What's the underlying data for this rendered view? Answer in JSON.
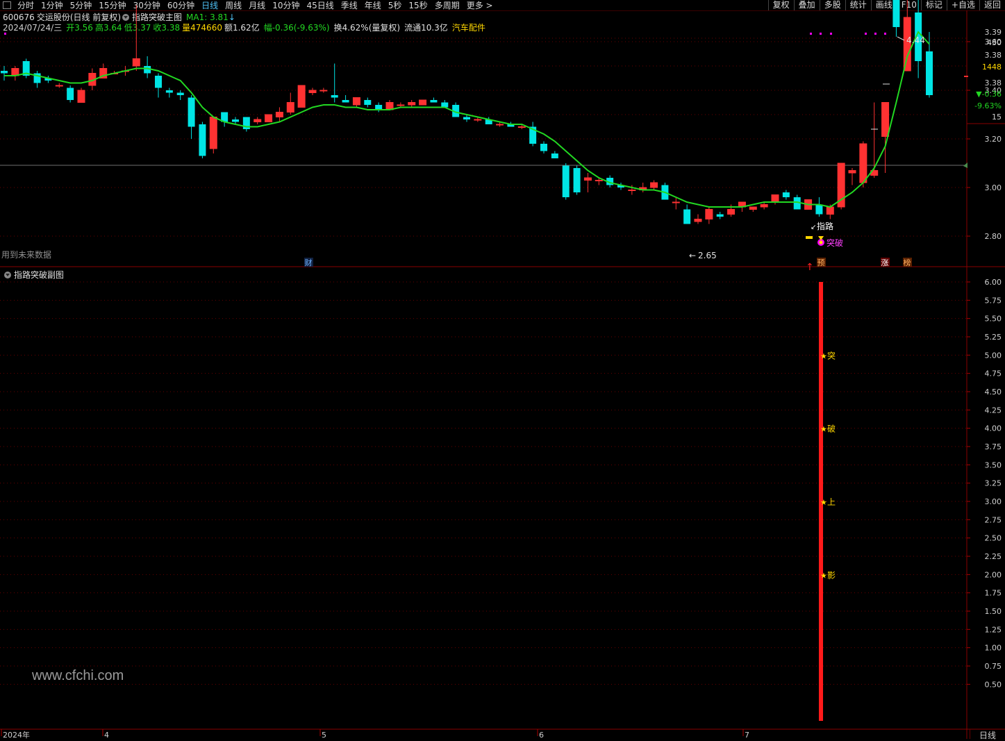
{
  "toolbar": {
    "periods": [
      "分时",
      "1分钟",
      "5分钟",
      "15分钟",
      "30分钟",
      "60分钟",
      "日线",
      "周线",
      "月线",
      "10分钟",
      "45日线",
      "季线",
      "年线",
      "5秒",
      "15秒",
      "多周期",
      "更多 >"
    ],
    "active_period": "日线",
    "right_buttons": [
      "复权",
      "叠加",
      "多股",
      "统计",
      "画线",
      "F10",
      "标记",
      "+自选",
      "返回"
    ]
  },
  "stock": {
    "code": "600676",
    "name": "交运股份",
    "mode": "(日线 前复权)",
    "indicator_main": "指路突破主图",
    "ma_label": "MA1: 3.81",
    "ma_arrow": "↓",
    "date": "2024/07/24/三",
    "open": "开3.56",
    "high": "高3.64",
    "low": "低3.37",
    "close": "收3.38",
    "volume": "量474660",
    "amount": "额1.62亿",
    "change": "幅-0.36(-9.63%)",
    "turnover": "换4.62%(量复权)",
    "float_cap": "流通10.3亿",
    "sector": "汽车配件"
  },
  "main_panel": {
    "note": "用到未来数据",
    "y_ticks": [
      "3.60",
      "3.40",
      "3.20",
      "3.00",
      "2.80"
    ],
    "side_stats": [
      "3.39",
      "430",
      "3.38",
      "1448",
      "3.38",
      "▼-0.36",
      "-9.63%",
      "15"
    ],
    "annotations": {
      "high_label": "4.44",
      "low_label": "2.65",
      "zhilu_label": "指路",
      "tupo_label": "突破",
      "cai_label": "财",
      "yu_label": "预",
      "zhang_label": "涨",
      "bang_label": "榜"
    }
  },
  "sub_panel": {
    "title": "指路突破副图",
    "y_ticks": [
      "6.00",
      "5.75",
      "5.50",
      "5.25",
      "5.00",
      "4.75",
      "4.50",
      "4.25",
      "4.00",
      "3.75",
      "3.50",
      "3.25",
      "3.00",
      "2.75",
      "2.50",
      "2.25",
      "2.00",
      "1.75",
      "1.50",
      "1.25",
      "1.00",
      "0.75",
      "0.50"
    ],
    "signals": [
      "突",
      "破",
      "上",
      "影"
    ]
  },
  "x_axis": {
    "labels": [
      "2024年",
      "4",
      "5",
      "6",
      "7"
    ]
  },
  "period_button": "日线",
  "watermark": "www.cfchi.com",
  "colors": {
    "up": "#ff3232",
    "down": "#00e5e5",
    "ma": "#22d822",
    "signal_bar": "#ff1a1a",
    "star": "#ffd700",
    "magenta": "#ff00ff"
  },
  "chart_data": {
    "type": "candlestick",
    "y_range": [
      2.6,
      3.95
    ],
    "candles": [
      {
        "o": 3.48,
        "h": 3.5,
        "l": 3.44,
        "c": 3.47
      },
      {
        "o": 3.46,
        "h": 3.5,
        "l": 3.44,
        "c": 3.49
      },
      {
        "o": 3.52,
        "h": 3.53,
        "l": 3.45,
        "c": 3.46
      },
      {
        "o": 3.47,
        "h": 3.48,
        "l": 3.41,
        "c": 3.43
      },
      {
        "o": 3.45,
        "h": 3.46,
        "l": 3.43,
        "c": 3.44
      },
      {
        "o": 3.42,
        "h": 3.43,
        "l": 3.41,
        "c": 3.42
      },
      {
        "o": 3.41,
        "h": 3.42,
        "l": 3.35,
        "c": 3.36
      },
      {
        "o": 3.35,
        "h": 3.41,
        "l": 3.35,
        "c": 3.4
      },
      {
        "o": 3.42,
        "h": 3.49,
        "l": 3.4,
        "c": 3.47
      },
      {
        "o": 3.45,
        "h": 3.51,
        "l": 3.45,
        "c": 3.49
      },
      {
        "o": 3.47,
        "h": 3.48,
        "l": 3.47,
        "c": 3.47
      },
      {
        "o": 3.48,
        "h": 3.5,
        "l": 3.46,
        "c": 3.48
      },
      {
        "o": 3.5,
        "h": 3.75,
        "l": 3.48,
        "c": 3.53
      },
      {
        "o": 3.5,
        "h": 3.54,
        "l": 3.45,
        "c": 3.47
      },
      {
        "o": 3.46,
        "h": 3.47,
        "l": 3.37,
        "c": 3.41
      },
      {
        "o": 3.4,
        "h": 3.41,
        "l": 3.37,
        "c": 3.39
      },
      {
        "o": 3.39,
        "h": 3.4,
        "l": 3.36,
        "c": 3.38
      },
      {
        "o": 3.37,
        "h": 3.38,
        "l": 3.2,
        "c": 3.25
      },
      {
        "o": 3.26,
        "h": 3.27,
        "l": 3.12,
        "c": 3.13
      },
      {
        "o": 3.16,
        "h": 3.29,
        "l": 3.14,
        "c": 3.29
      },
      {
        "o": 3.31,
        "h": 3.31,
        "l": 3.25,
        "c": 3.27
      },
      {
        "o": 3.28,
        "h": 3.29,
        "l": 3.26,
        "c": 3.27
      },
      {
        "o": 3.29,
        "h": 3.29,
        "l": 3.23,
        "c": 3.24
      },
      {
        "o": 3.27,
        "h": 3.29,
        "l": 3.26,
        "c": 3.28
      },
      {
        "o": 3.27,
        "h": 3.3,
        "l": 3.27,
        "c": 3.3
      },
      {
        "o": 3.29,
        "h": 3.33,
        "l": 3.27,
        "c": 3.31
      },
      {
        "o": 3.31,
        "h": 3.39,
        "l": 3.3,
        "c": 3.35
      },
      {
        "o": 3.33,
        "h": 3.42,
        "l": 3.33,
        "c": 3.42
      },
      {
        "o": 3.39,
        "h": 3.41,
        "l": 3.38,
        "c": 3.4
      },
      {
        "o": 3.4,
        "h": 3.41,
        "l": 3.39,
        "c": 3.4
      },
      {
        "o": 3.38,
        "h": 3.51,
        "l": 3.35,
        "c": 3.37
      },
      {
        "o": 3.36,
        "h": 3.38,
        "l": 3.35,
        "c": 3.35
      },
      {
        "o": 3.34,
        "h": 3.37,
        "l": 3.33,
        "c": 3.37
      },
      {
        "o": 3.36,
        "h": 3.37,
        "l": 3.33,
        "c": 3.34
      },
      {
        "o": 3.34,
        "h": 3.35,
        "l": 3.31,
        "c": 3.32
      },
      {
        "o": 3.32,
        "h": 3.36,
        "l": 3.32,
        "c": 3.35
      },
      {
        "o": 3.34,
        "h": 3.35,
        "l": 3.33,
        "c": 3.34
      },
      {
        "o": 3.34,
        "h": 3.36,
        "l": 3.33,
        "c": 3.35
      },
      {
        "o": 3.34,
        "h": 3.36,
        "l": 3.34,
        "c": 3.36
      },
      {
        "o": 3.36,
        "h": 3.37,
        "l": 3.35,
        "c": 3.35
      },
      {
        "o": 3.35,
        "h": 3.36,
        "l": 3.33,
        "c": 3.33
      },
      {
        "o": 3.34,
        "h": 3.35,
        "l": 3.29,
        "c": 3.29
      },
      {
        "o": 3.29,
        "h": 3.3,
        "l": 3.27,
        "c": 3.28
      },
      {
        "o": 3.28,
        "h": 3.29,
        "l": 3.27,
        "c": 3.28
      },
      {
        "o": 3.28,
        "h": 3.29,
        "l": 3.26,
        "c": 3.26
      },
      {
        "o": 3.26,
        "h": 3.27,
        "l": 3.25,
        "c": 3.26
      },
      {
        "o": 3.26,
        "h": 3.27,
        "l": 3.25,
        "c": 3.25
      },
      {
        "o": 3.25,
        "h": 3.26,
        "l": 3.24,
        "c": 3.25
      },
      {
        "o": 3.25,
        "h": 3.27,
        "l": 3.17,
        "c": 3.18
      },
      {
        "o": 3.18,
        "h": 3.19,
        "l": 3.14,
        "c": 3.15
      },
      {
        "o": 3.14,
        "h": 3.15,
        "l": 3.12,
        "c": 3.12
      },
      {
        "o": 3.09,
        "h": 3.1,
        "l": 2.95,
        "c": 2.96
      },
      {
        "o": 3.08,
        "h": 3.09,
        "l": 2.97,
        "c": 2.98
      },
      {
        "o": 3.03,
        "h": 3.06,
        "l": 2.98,
        "c": 3.04
      },
      {
        "o": 3.03,
        "h": 3.04,
        "l": 3.01,
        "c": 3.03
      },
      {
        "o": 3.04,
        "h": 3.05,
        "l": 3.0,
        "c": 3.01
      },
      {
        "o": 3.01,
        "h": 3.02,
        "l": 2.99,
        "c": 3.0
      },
      {
        "o": 2.99,
        "h": 3.01,
        "l": 2.97,
        "c": 2.99
      },
      {
        "o": 2.99,
        "h": 3.02,
        "l": 2.98,
        "c": 3.0
      },
      {
        "o": 3.0,
        "h": 3.03,
        "l": 2.99,
        "c": 3.02
      },
      {
        "o": 3.01,
        "h": 3.02,
        "l": 2.95,
        "c": 2.95
      },
      {
        "o": 2.94,
        "h": 2.96,
        "l": 2.91,
        "c": 2.94
      },
      {
        "o": 2.91,
        "h": 2.93,
        "l": 2.86,
        "c": 2.85
      },
      {
        "o": 2.86,
        "h": 2.89,
        "l": 2.85,
        "c": 2.87
      },
      {
        "o": 2.87,
        "h": 2.92,
        "l": 2.85,
        "c": 2.91
      },
      {
        "o": 2.89,
        "h": 2.9,
        "l": 2.87,
        "c": 2.88
      },
      {
        "o": 2.89,
        "h": 2.93,
        "l": 2.88,
        "c": 2.91
      },
      {
        "o": 2.92,
        "h": 2.94,
        "l": 2.9,
        "c": 2.94
      },
      {
        "o": 2.91,
        "h": 2.92,
        "l": 2.9,
        "c": 2.92
      },
      {
        "o": 2.92,
        "h": 2.94,
        "l": 2.91,
        "c": 2.93
      },
      {
        "o": 2.94,
        "h": 2.97,
        "l": 2.93,
        "c": 2.97
      },
      {
        "o": 2.98,
        "h": 2.99,
        "l": 2.95,
        "c": 2.96
      },
      {
        "o": 2.96,
        "h": 2.97,
        "l": 2.91,
        "c": 2.91
      },
      {
        "o": 2.91,
        "h": 2.95,
        "l": 2.91,
        "c": 2.95
      },
      {
        "o": 2.93,
        "h": 2.96,
        "l": 2.88,
        "c": 2.89
      },
      {
        "o": 2.89,
        "h": 2.93,
        "l": 2.87,
        "c": 2.92
      },
      {
        "o": 2.92,
        "h": 3.1,
        "l": 2.91,
        "c": 3.1
      },
      {
        "o": 3.06,
        "h": 3.08,
        "l": 3.01,
        "c": 3.07
      },
      {
        "o": 3.02,
        "h": 3.19,
        "l": 3.0,
        "c": 3.18
      },
      {
        "o": 3.05,
        "h": 3.35,
        "l": 3.04,
        "c": 3.07
      },
      {
        "o": 3.21,
        "h": 3.35,
        "l": 3.06,
        "c": 3.35
      },
      {
        "o": 3.8,
        "h": 3.95,
        "l": 3.62,
        "c": 3.66
      },
      {
        "o": 3.48,
        "h": 3.9,
        "l": 3.55,
        "c": 3.7
      },
      {
        "o": 3.72,
        "h": 3.8,
        "l": 3.45,
        "c": 3.52
      },
      {
        "o": 3.56,
        "h": 3.64,
        "l": 3.37,
        "c": 3.38
      }
    ],
    "ma": [
      3.46,
      3.46,
      3.47,
      3.46,
      3.45,
      3.44,
      3.43,
      3.43,
      3.44,
      3.46,
      3.47,
      3.48,
      3.49,
      3.49,
      3.48,
      3.46,
      3.44,
      3.39,
      3.33,
      3.29,
      3.27,
      3.26,
      3.25,
      3.25,
      3.26,
      3.27,
      3.29,
      3.31,
      3.33,
      3.34,
      3.34,
      3.33,
      3.33,
      3.32,
      3.32,
      3.32,
      3.33,
      3.33,
      3.33,
      3.33,
      3.33,
      3.31,
      3.3,
      3.29,
      3.28,
      3.27,
      3.26,
      3.26,
      3.24,
      3.22,
      3.19,
      3.15,
      3.11,
      3.07,
      3.04,
      3.02,
      3.01,
      3.0,
      2.99,
      2.99,
      2.98,
      2.96,
      2.94,
      2.93,
      2.92,
      2.92,
      2.92,
      2.92,
      2.93,
      2.94,
      2.94,
      2.94,
      2.94,
      2.93,
      2.93,
      2.92,
      2.95,
      2.98,
      3.02,
      3.08,
      3.17,
      3.35,
      3.54,
      3.64,
      3.59
    ]
  }
}
